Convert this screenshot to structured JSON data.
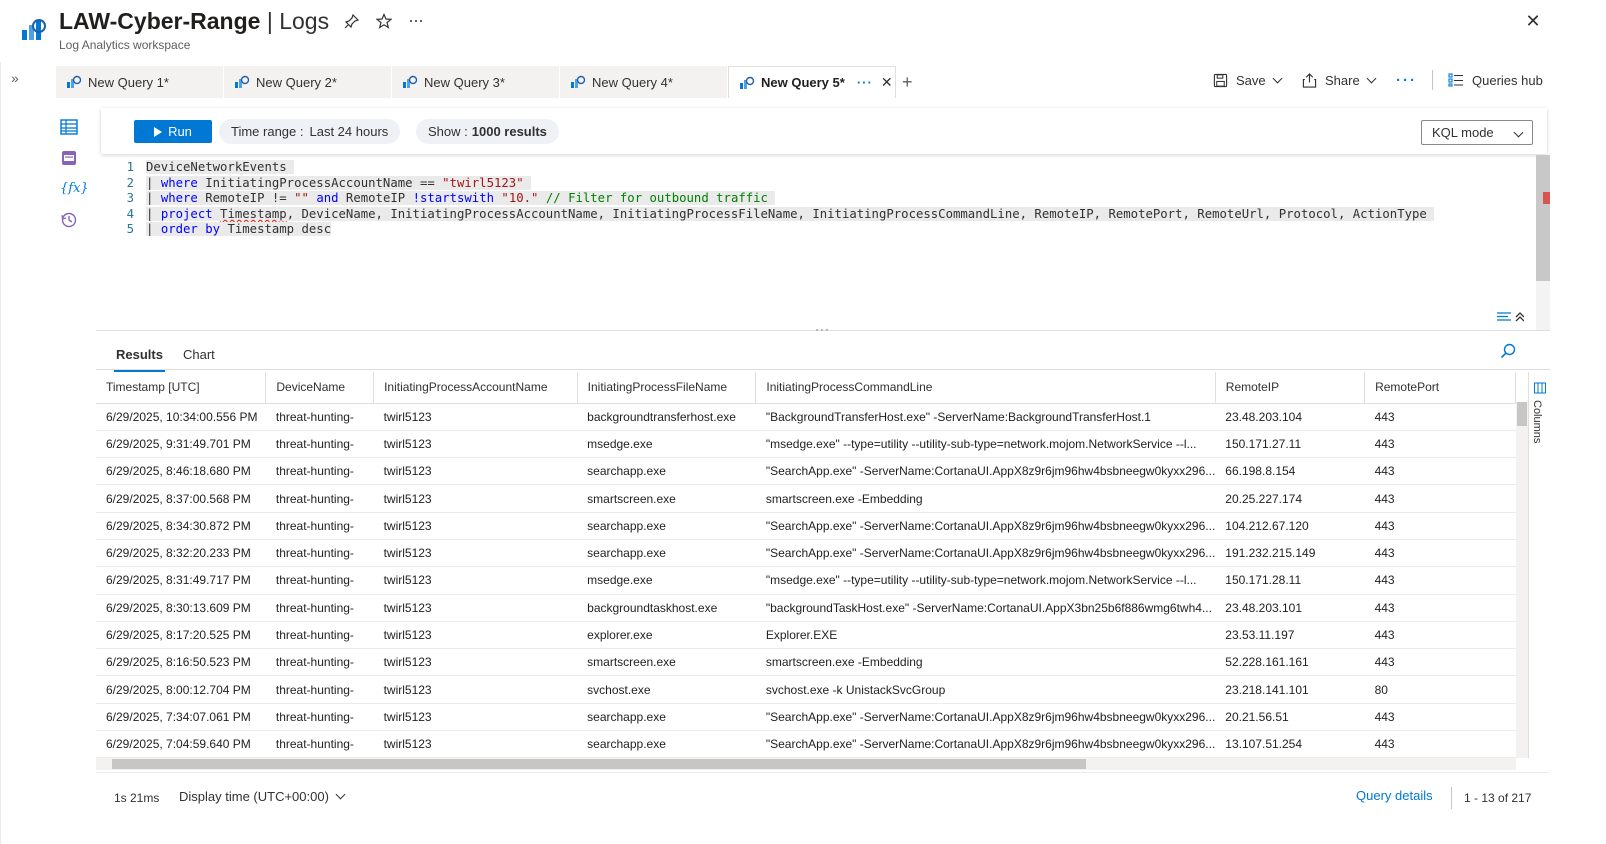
{
  "header": {
    "title_main": "LAW-Cyber-Range",
    "title_sep": " | Logs",
    "subtitle": "Log Analytics workspace",
    "icons": [
      "pin-icon",
      "star-icon",
      "more-icon"
    ],
    "close_glyph": "✕"
  },
  "tabs": [
    {
      "label": "New Query 1*"
    },
    {
      "label": "New Query 2*"
    },
    {
      "label": "New Query 3*"
    },
    {
      "label": "New Query 4*"
    },
    {
      "label": "New Query 5*",
      "active": true
    }
  ],
  "toolbar": {
    "save": "Save",
    "share": "Share",
    "more": "···",
    "queries_hub": "Queries hub"
  },
  "query_bar": {
    "run": "Run",
    "time_range_label": "Time range :",
    "time_range_value": "Last 24 hours",
    "show_label": "Show :",
    "show_value": "1000 results",
    "mode": "KQL mode"
  },
  "editor": {
    "line_numbers": [
      "1",
      "2",
      "3",
      "4",
      "5"
    ]
  },
  "results": {
    "tabs": [
      "Results",
      "Chart"
    ],
    "columns": [
      "Timestamp [UTC]",
      "DeviceName",
      "InitiatingProcessAccountName",
      "InitiatingProcessFileName",
      "InitiatingProcessCommandLine",
      "RemoteIP",
      "RemotePort"
    ],
    "columns_panel": "Columns",
    "rows": [
      [
        "6/29/2025, 10:34:00.556 PM",
        "threat-hunting-",
        "twirl5123",
        "backgroundtransferhost.exe",
        "\"BackgroundTransferHost.exe\" -ServerName:BackgroundTransferHost.1",
        "23.48.203.104",
        "443"
      ],
      [
        "6/29/2025, 9:31:49.701 PM",
        "threat-hunting-",
        "twirl5123",
        "msedge.exe",
        "\"msedge.exe\" --type=utility --utility-sub-type=network.mojom.NetworkService --l...",
        "150.171.27.11",
        "443"
      ],
      [
        "6/29/2025, 8:46:18.680 PM",
        "threat-hunting-",
        "twirl5123",
        "searchapp.exe",
        "\"SearchApp.exe\" -ServerName:CortanaUI.AppX8z9r6jm96hw4bsbneegw0kyxx296...",
        "66.198.8.154",
        "443"
      ],
      [
        "6/29/2025, 8:37:00.568 PM",
        "threat-hunting-",
        "twirl5123",
        "smartscreen.exe",
        "smartscreen.exe -Embedding",
        "20.25.227.174",
        "443"
      ],
      [
        "6/29/2025, 8:34:30.872 PM",
        "threat-hunting-",
        "twirl5123",
        "searchapp.exe",
        "\"SearchApp.exe\" -ServerName:CortanaUI.AppX8z9r6jm96hw4bsbneegw0kyxx296...",
        "104.212.67.120",
        "443"
      ],
      [
        "6/29/2025, 8:32:20.233 PM",
        "threat-hunting-",
        "twirl5123",
        "searchapp.exe",
        "\"SearchApp.exe\" -ServerName:CortanaUI.AppX8z9r6jm96hw4bsbneegw0kyxx296...",
        "191.232.215.149",
        "443"
      ],
      [
        "6/29/2025, 8:31:49.717 PM",
        "threat-hunting-",
        "twirl5123",
        "msedge.exe",
        "\"msedge.exe\" --type=utility --utility-sub-type=network.mojom.NetworkService --l...",
        "150.171.28.11",
        "443"
      ],
      [
        "6/29/2025, 8:30:13.609 PM",
        "threat-hunting-",
        "twirl5123",
        "backgroundtaskhost.exe",
        "\"backgroundTaskHost.exe\" -ServerName:CortanaUI.AppX3bn25b6f886wmg6twh4...",
        "23.48.203.101",
        "443"
      ],
      [
        "6/29/2025, 8:17:20.525 PM",
        "threat-hunting-",
        "twirl5123",
        "explorer.exe",
        "Explorer.EXE",
        "23.53.11.197",
        "443"
      ],
      [
        "6/29/2025, 8:16:50.523 PM",
        "threat-hunting-",
        "twirl5123",
        "smartscreen.exe",
        "smartscreen.exe -Embedding",
        "52.228.161.161",
        "443"
      ],
      [
        "6/29/2025, 8:00:12.704 PM",
        "threat-hunting-",
        "twirl5123",
        "svchost.exe",
        "svchost.exe -k UnistackSvcGroup",
        "23.218.141.101",
        "80"
      ],
      [
        "6/29/2025, 7:34:07.061 PM",
        "threat-hunting-",
        "twirl5123",
        "searchapp.exe",
        "\"SearchApp.exe\" -ServerName:CortanaUI.AppX8z9r6jm96hw4bsbneegw0kyxx296...",
        "20.21.56.51",
        "443"
      ],
      [
        "6/29/2025, 7:04:59.640 PM",
        "threat-hunting-",
        "twirl5123",
        "searchapp.exe",
        "\"SearchApp.exe\" -ServerName:CortanaUI.AppX8z9r6jm96hw4bsbneegw0kyxx296...",
        "13.107.51.254",
        "443"
      ]
    ]
  },
  "footer": {
    "duration": "1s 21ms",
    "display_time": "Display time (UTC+00:00)",
    "query_details": "Query details",
    "paging": "1 - 13 of 217"
  },
  "colors": {
    "accent": "#0078d4",
    "tab_bg": "#f3f2f1"
  }
}
